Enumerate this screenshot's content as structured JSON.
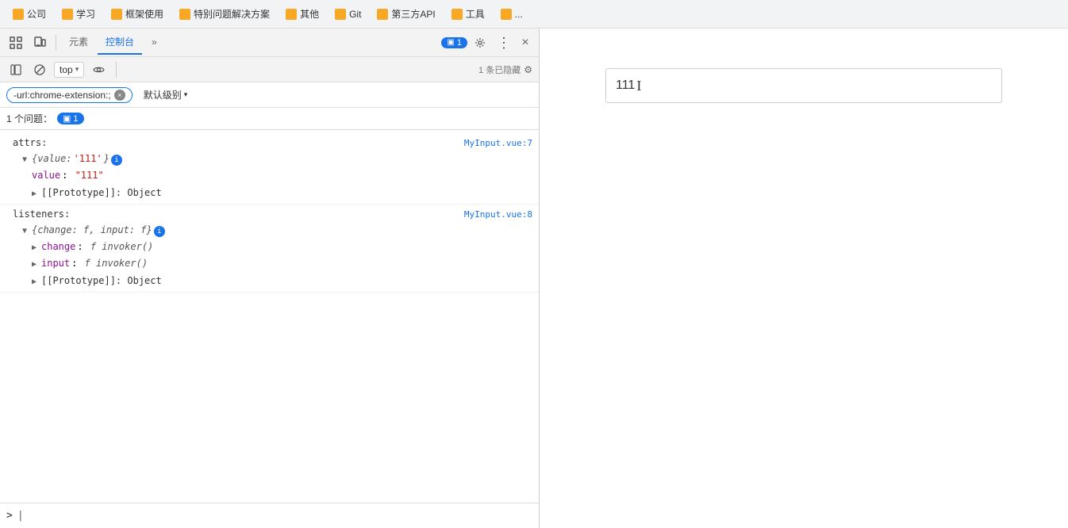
{
  "bookmarks": {
    "items": [
      {
        "label": "公司",
        "icon": "folder"
      },
      {
        "label": "学习",
        "icon": "folder"
      },
      {
        "label": "框架使用",
        "icon": "folder"
      },
      {
        "label": "特别问题解决方案",
        "icon": "folder"
      },
      {
        "label": "其他",
        "icon": "folder"
      },
      {
        "label": "Git",
        "icon": "folder"
      },
      {
        "label": "第三方API",
        "icon": "folder"
      },
      {
        "label": "工具",
        "icon": "folder"
      },
      {
        "label": "...",
        "icon": "folder"
      }
    ]
  },
  "devtools": {
    "toolbar": {
      "inspect_label": "☰",
      "device_label": "⧉",
      "elements_tab": "元素",
      "console_tab": "控制台",
      "more_tabs": "»",
      "badge_icon": "▣",
      "badge_count": "1",
      "settings_icon": "⚙",
      "more_icon": "⋮",
      "close_icon": "×"
    },
    "console_bar": {
      "sidebar_icon": "⊞",
      "clear_icon": "🚫",
      "top_label": "top",
      "eye_icon": "👁",
      "hidden_label": "1 条已隐藏",
      "gear_icon": "⚙"
    },
    "filter": {
      "chip_text": "-url:chrome-extension:;",
      "level_label": "默认级别",
      "level_arrow": "▾",
      "separator": "|"
    },
    "issues": {
      "label": "1 个问题：",
      "badge_icon": "▣",
      "badge_count": "1"
    },
    "entries": [
      {
        "id": "attrs-entry",
        "label": "attrs:",
        "source": "MyInput.vue:7",
        "children": [
          {
            "type": "object-summary",
            "text": "{value: '111'}",
            "italic": true,
            "has_info": true
          },
          {
            "type": "key-value",
            "key": "value",
            "value": "\"111\"",
            "indent": 2
          },
          {
            "type": "prototype",
            "text": "[[Prototype]]: Object",
            "indent": 2
          }
        ]
      },
      {
        "id": "listeners-entry",
        "label": "listeners:",
        "source": "MyInput.vue:8",
        "children": [
          {
            "type": "object-summary",
            "text": "{change: f, input: f}",
            "italic": true,
            "has_info": true
          },
          {
            "type": "expandable",
            "key": "change",
            "value": "f invoker()",
            "indent": 2
          },
          {
            "type": "expandable",
            "key": "input",
            "value": "f invoker()",
            "indent": 2
          },
          {
            "type": "prototype",
            "text": "[[Prototype]]: Object",
            "indent": 2
          }
        ]
      }
    ],
    "prompt": ">"
  },
  "preview": {
    "input_value": "111",
    "cursor_symbol": "I"
  }
}
